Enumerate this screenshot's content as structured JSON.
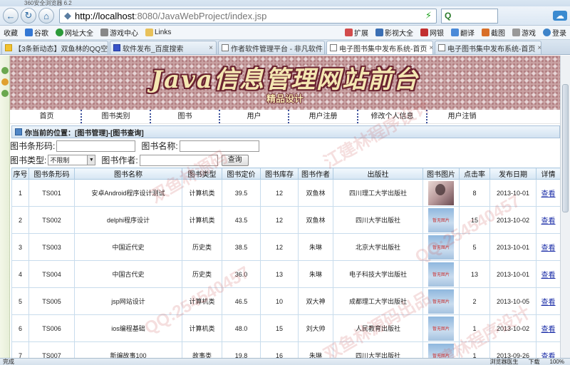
{
  "browser": {
    "window_title": "360安全浏览器 6.2",
    "nav_buttons": [
      "back-icon",
      "refresh-icon",
      "home-icon"
    ],
    "url_host": "http://localhost",
    "url_rest": ":8080/JavaWebProject/index.jsp",
    "search_engine_label": "Q",
    "tools_label": "扩展",
    "bookmarks": [
      "收藏",
      "谷歌",
      "网址大全",
      "游戏中心",
      "Links"
    ],
    "bookmarks_right": [
      "扩展",
      "影视大全",
      "网银",
      "翻译",
      "截图",
      "游戏",
      "登录"
    ],
    "tabs": [
      {
        "label": "【3条新动态】双鱼林的QQ空间",
        "active": false
      },
      {
        "label": "软件发布_百度搜索",
        "active": false
      },
      {
        "label": "作者软件管理平台 - 非凡软件",
        "active": false
      },
      {
        "label": "电子图书集中发布系统-首页",
        "active": true
      },
      {
        "label": "电子图书集中发布系统-首页",
        "active": false
      }
    ],
    "status_left": "完成",
    "status_right": [
      "浏览器医生",
      "下载",
      "100%"
    ]
  },
  "site": {
    "title": "Java信息管理网站前台",
    "subtitle": "精品设计"
  },
  "menu": [
    "首页",
    "图书类别",
    "图书",
    "用户",
    "用户注册",
    "修改个人信息",
    "用户注销"
  ],
  "location_text": "你当前的位置：[图书管理]-[图书查询]",
  "query": {
    "barcode_label": "图书条形码:",
    "barcode_value": "",
    "name_label": "图书名称:",
    "name_value": "",
    "type_label": "图书类型:",
    "type_selected": "不限制",
    "author_label": "图书作者:",
    "author_value": "",
    "search_button": "查询"
  },
  "table": {
    "headers": [
      "序号",
      "图书条形码",
      "图书名称",
      "图书类型",
      "图书定价",
      "图书库存",
      "图书作者",
      "出版社",
      "图书图片",
      "点击率",
      "发布日期",
      "详情"
    ],
    "placeholder_image_text": "暂无图片",
    "detail_link": "查看",
    "rows": [
      {
        "no": "1",
        "barcode": "TS001",
        "name": "安卓Android程序设计测试",
        "type": "计算机类",
        "price": "39.5",
        "stock": "12",
        "author": "双鱼林",
        "publisher": "四川理工大学出版社",
        "image": "photo",
        "clicks": "8",
        "date": "2013-10-01"
      },
      {
        "no": "2",
        "barcode": "TS002",
        "name": "delphi程序设计",
        "type": "计算机类",
        "price": "43.5",
        "stock": "12",
        "author": "双鱼林",
        "publisher": "四川大学出版社",
        "image": "placeholder",
        "clicks": "15",
        "date": "2013-10-02"
      },
      {
        "no": "3",
        "barcode": "TS003",
        "name": "中国近代史",
        "type": "历史类",
        "price": "38.5",
        "stock": "12",
        "author": "朱琳",
        "publisher": "北京大学出版社",
        "image": "placeholder",
        "clicks": "5",
        "date": "2013-10-01"
      },
      {
        "no": "4",
        "barcode": "TS004",
        "name": "中国古代史",
        "type": "历史类",
        "price": "36.0",
        "stock": "13",
        "author": "朱琳",
        "publisher": "电子科技大学出版社",
        "image": "placeholder",
        "clicks": "13",
        "date": "2013-10-01"
      },
      {
        "no": "5",
        "barcode": "TS005",
        "name": "jsp网站设计",
        "type": "计算机类",
        "price": "46.5",
        "stock": "10",
        "author": "双大神",
        "publisher": "成都理工大学出版社",
        "image": "placeholder",
        "clicks": "2",
        "date": "2013-10-05"
      },
      {
        "no": "6",
        "barcode": "TS006",
        "name": "ios编程基础",
        "type": "计算机类",
        "price": "48.0",
        "stock": "15",
        "author": "刘大帅",
        "publisher": "人民教育出版社",
        "image": "placeholder",
        "clicks": "1",
        "date": "2013-10-02"
      },
      {
        "no": "7",
        "barcode": "TS007",
        "name": "新编故事100",
        "type": "故事类",
        "price": "19.8",
        "stock": "16",
        "author": "朱琳",
        "publisher": "四川大学出版社",
        "image": "placeholder",
        "clicks": "1",
        "date": "2013-09-26"
      }
    ]
  },
  "watermarks": [
    "双鱼林源码",
    "QQ:254540457",
    "江建林程序设计",
    "双鱼林源码出品",
    "QQ:254540457",
    "江建林程序设计"
  ]
}
